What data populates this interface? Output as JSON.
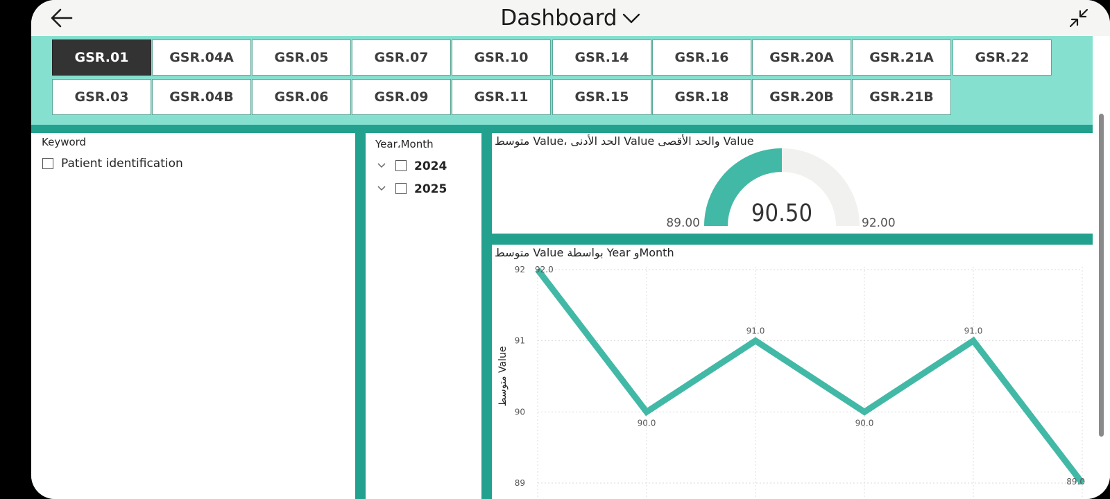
{
  "header": {
    "title": "Dashboard",
    "back_icon": "arrow-left-icon",
    "dropdown_icon": "chevron-down-icon",
    "collapse_icon": "collapse-arrows-icon"
  },
  "colors": {
    "accent": "#42b9a6",
    "frame": "#22a18e",
    "button_area": "#85e0cf",
    "active_button": "#333333"
  },
  "nav_buttons": {
    "row1": [
      "GSR.01",
      "GSR.04A",
      "GSR.05",
      "GSR.07",
      "GSR.10",
      "GSR.14",
      "GSR.16",
      "GSR.20A",
      "GSR.21A",
      "GSR.22"
    ],
    "row2": [
      "GSR.03",
      "GSR.04B",
      "GSR.06",
      "GSR.09",
      "GSR.11",
      "GSR.15",
      "GSR.18",
      "GSR.20B",
      "GSR.21B"
    ],
    "active": "GSR.01"
  },
  "keyword_slicer": {
    "title": "Keyword",
    "items": [
      {
        "label": "Patient identification",
        "checked": false
      }
    ]
  },
  "year_slicer": {
    "title": "Year،Month",
    "items": [
      {
        "label": "2024",
        "checked": false,
        "expanded": false
      },
      {
        "label": "2025",
        "checked": false,
        "expanded": false
      }
    ]
  },
  "gauge": {
    "title": "متوسط Value، الحد الأدنى Value والحد الأقصى Value",
    "min_label": "89.00",
    "max_label": "92.00",
    "value_label": "90.50",
    "min": 89,
    "max": 92,
    "value": 90.5
  },
  "line_chart": {
    "title": "متوسط Value بواسطة Year وMonth"
  },
  "chart_data": {
    "type": "line",
    "title": "متوسط Value بواسطة Year وMonth",
    "ylabel": "متوسط Value",
    "xlabel": "",
    "ylim": [
      89,
      92
    ],
    "y_ticks": [
      "89",
      "90",
      "91",
      "92"
    ],
    "grid": true,
    "series": [
      {
        "values": [
          92.0,
          90.0,
          91.0,
          90.0,
          91.0,
          89.0
        ]
      }
    ],
    "data_labels": [
      "92.0",
      "90.0",
      "91.0",
      "90.0",
      "91.0",
      "89.0"
    ]
  }
}
